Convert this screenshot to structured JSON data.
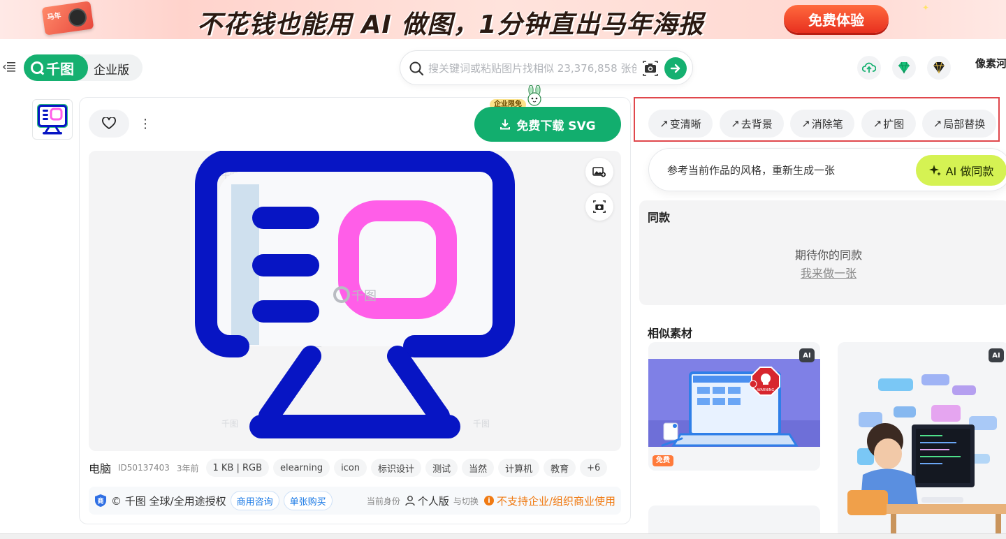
{
  "banner": {
    "slogan": "不花钱也能用 AI 做图，1分钟直出马年海报",
    "cta": "免费体验",
    "ticket_text": "马年"
  },
  "header": {
    "brand": "千图",
    "edition": "企业版",
    "search_placeholder": "搜关键词或粘贴图片找相似 23,376,858 张创",
    "user_name": "像素河"
  },
  "asset": {
    "download_label": "免费下载 SVG",
    "enterprise_badge": "企业限免",
    "more_label": "⋮",
    "title": "电脑",
    "id": "ID50137403",
    "age": "3年前",
    "size": "1 KB | RGB",
    "tags": [
      "elearning",
      "icon",
      "标识设计",
      "测试",
      "当然",
      "计算机",
      "教育"
    ],
    "more_tags": "+6",
    "watermark": "千图"
  },
  "license": {
    "badge": "商",
    "text": "© 千图 全球/全用途授权",
    "consult": "商用咨询",
    "buy": "单张购买",
    "identity_label": "当前身份",
    "identity": "个人版",
    "switch": "与切换",
    "warning": "不支持企业/组织商业使用"
  },
  "ai_tools": [
    {
      "label": "变清晰"
    },
    {
      "label": "去背景"
    },
    {
      "label": "消除笔"
    },
    {
      "label": "扩图"
    },
    {
      "label": "局部替换"
    }
  ],
  "ai_generate": {
    "prompt": "参考当前作品的风格，重新生成一张",
    "button": "AI 做同款"
  },
  "same": {
    "title": "同款",
    "empty": "期待你的同款",
    "link": "我来做一张"
  },
  "similar": {
    "title": "相似素材",
    "ai_tag": "AI",
    "free_tag": "免费",
    "warning_sign": "WARNING"
  },
  "colors": {
    "brand_green": "#15b070",
    "monitor_blue": "#0715c4",
    "screen_pink": "#ff5ee8",
    "highlight_red": "#e0474c"
  }
}
